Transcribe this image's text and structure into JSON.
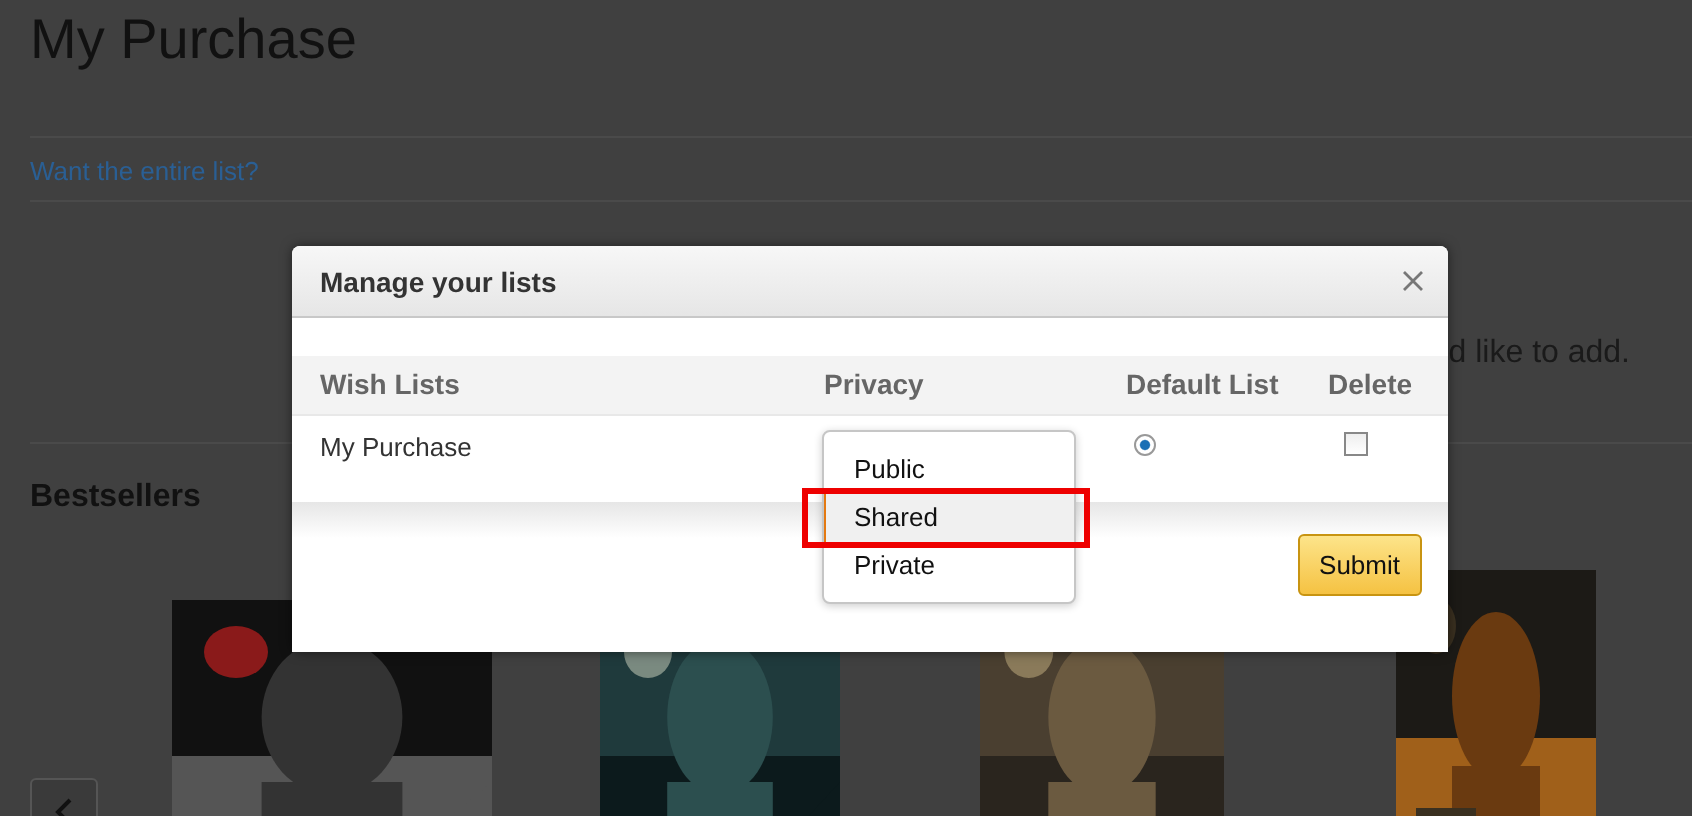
{
  "page": {
    "title": "My Purchase",
    "link": "Want the entire list?",
    "partial_text": "d like to add.",
    "section_title": "Bestsellers"
  },
  "dialog": {
    "title": "Manage your lists",
    "columns": [
      "Wish Lists",
      "Privacy",
      "Default List",
      "Delete"
    ],
    "rows": [
      {
        "name": "My Purchase",
        "default": true,
        "delete": false,
        "privacy_open": true,
        "privacy_options": [
          {
            "label": "Public",
            "selected": false,
            "annotated": false
          },
          {
            "label": "Shared",
            "selected": true,
            "annotated": true
          },
          {
            "label": "Private",
            "selected": false,
            "annotated": false
          }
        ]
      }
    ],
    "submit": "Submit"
  }
}
